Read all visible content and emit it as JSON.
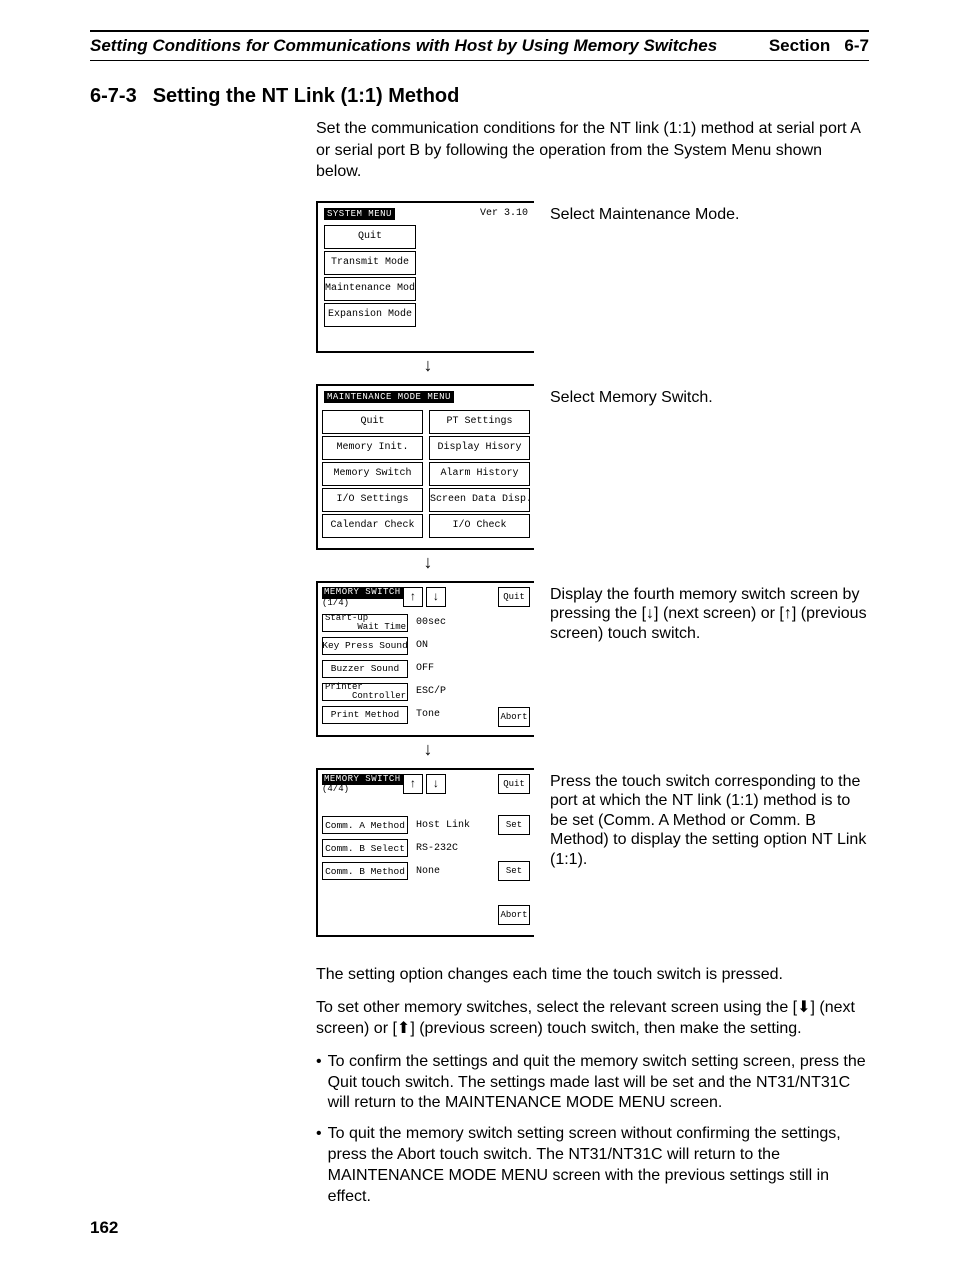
{
  "header": {
    "left": "Setting Conditions for Communications with Host by Using Memory Switches",
    "section_word": "Section",
    "section_num": "6-7"
  },
  "section": {
    "num": "6-7-3",
    "title": "Setting the NT Link (1:1) Method"
  },
  "intro": "Set the communication conditions for the NT link (1:1) method at serial port A or serial port B by following the operation from the System Menu shown below.",
  "step1": {
    "panel_title": "SYSTEM MENU",
    "ver": "Ver 3.10",
    "buttons": [
      "Quit",
      "Transmit Mode",
      "Maintenance Mode",
      "Expansion Mode"
    ],
    "desc": "Select Maintenance Mode."
  },
  "step2": {
    "panel_title": "MAINTENANCE MODE MENU",
    "left": [
      "Quit",
      "Memory Init.",
      "Memory Switch",
      "I/O Settings",
      "Calendar Check"
    ],
    "right": [
      "PT Settings",
      "Display Hisory",
      "Alarm History",
      "Screen Data Disp.",
      "I/O Check"
    ],
    "desc": "Select Memory Switch."
  },
  "step3": {
    "panel_title": "MEMORY SWITCH",
    "page": "(1/4)",
    "quit": "Quit",
    "abort": "Abort",
    "rows": [
      {
        "label": "Start-up\n      Wait Time",
        "val": "00sec",
        "multi": true
      },
      {
        "label": "Key Press Sound",
        "val": "ON"
      },
      {
        "label": "Buzzer Sound",
        "val": "OFF"
      },
      {
        "label": "Printer\n     Controller",
        "val": "ESC/P",
        "multi": true
      },
      {
        "label": "Print Method",
        "val": "Tone"
      }
    ],
    "desc": "Display the fourth memory switch screen by pressing the [↓] (next screen) or [↑] (previous screen) touch switch."
  },
  "step4": {
    "panel_title": "MEMORY SWITCH",
    "page": "(4/4)",
    "quit": "Quit",
    "abort": "Abort",
    "set": "Set",
    "rows": [
      {
        "label": "Comm. A Method",
        "val": "Host Link",
        "set": true
      },
      {
        "label": "Comm. B Select",
        "val": "RS-232C"
      },
      {
        "label": "Comm. B Method",
        "val": "None",
        "set": true
      }
    ],
    "desc": "Press the touch switch corresponding to the port at which the NT link (1:1) method is to be set (Comm. A Method or Comm. B Method) to display the setting option NT Link (1:1)."
  },
  "para1": "The setting option changes each time the touch switch is pressed.",
  "para2": "To set other memory switches, select the relevant screen using the [⬇] (next screen) or [⬆] (previous screen) touch switch, then make the setting.",
  "bul1": "To confirm the settings and quit the memory switch setting screen, press the Quit touch switch. The settings made last will be set and the NT31/NT31C will return to the MAINTENANCE MODE MENU screen.",
  "bul2": "To quit the memory switch setting screen without confirming the settings, press the Abort touch switch. The NT31/NT31C will return to the MAINTENANCE MODE MENU screen with the previous settings still in effect.",
  "page_num": "162"
}
